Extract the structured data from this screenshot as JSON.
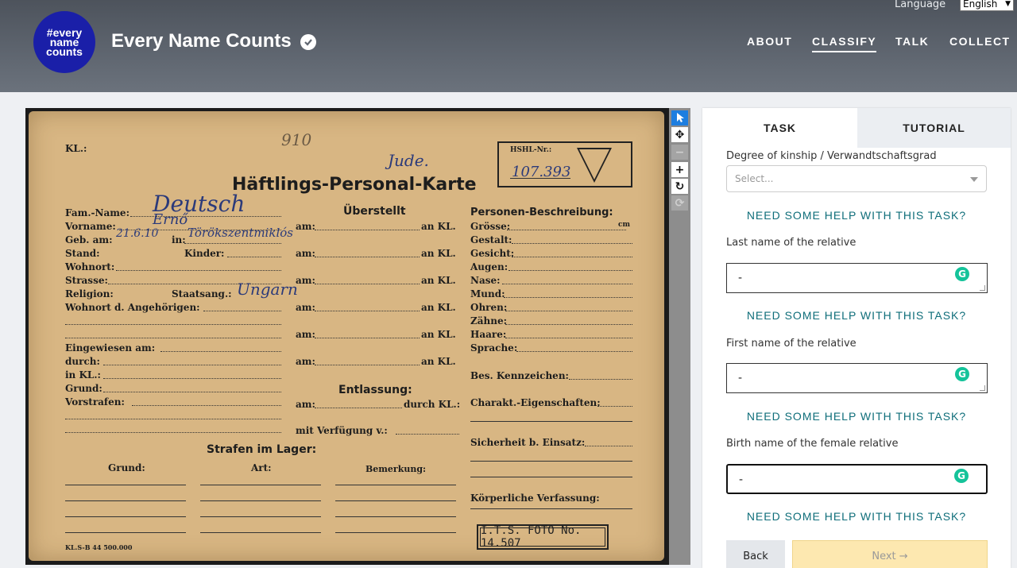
{
  "header": {
    "site_title": "Every Name Counts",
    "logo_text": [
      "#every",
      "name",
      "counts"
    ],
    "language_label": "Language",
    "language_value": "English",
    "nav": [
      {
        "label": "ABOUT",
        "active": false
      },
      {
        "label": "CLASSIFY",
        "active": true
      },
      {
        "label": "TALK",
        "active": false
      },
      {
        "label": "COLLECT",
        "active": false
      }
    ]
  },
  "document": {
    "top_left": "KL.:",
    "pencil_number": "910",
    "hftl_label": "HSHL-Nr.:",
    "prisoner_number": "107.393",
    "category_note": "Jude.",
    "title": "Häftlings-Personal-Karte",
    "left_labels": [
      "Fam.-Name:",
      "Vorname:",
      "Geb. am:",
      "Stand:",
      "Wohnort:",
      "Strasse:",
      "Religion:",
      "Wohnort d. Angehörigen:",
      "Eingewiesen am:",
      "durch:",
      "in KL.:",
      "Grund:",
      "Vorstrafen:"
    ],
    "in_label": "in:",
    "kinder_label": "Kinder:",
    "staatsang_label": "Staatsang.:",
    "family_name": "Deutsch",
    "first_name": "Ernő",
    "birth_date": "21.6.10",
    "birth_place": "Törökszentmiklós",
    "nationality": "Ungarn",
    "ueberstellt": "Überstellt",
    "am_label": "am:",
    "an_kl_label": "an KL.",
    "entlassung": "Entlassung:",
    "durch_kl": "durch KL.:",
    "verfuegung": "mit Verfügung v.:",
    "personen_title": "Personen-Beschreibung:",
    "right_labels": [
      "Grösse:",
      "Gestalt:",
      "Gesicht:",
      "Augen:",
      "Nase:",
      "Mund:",
      "Ohren:",
      "Zähne:",
      "Haare:",
      "Sprache:"
    ],
    "cm_label": "cm",
    "bes_kennzeichen": "Bes. Kennzeichen:",
    "charakt": "Charakt.-Eigenschaften:",
    "sicherheit": "Sicherheit b. Einsatz:",
    "koerper": "Körperliche Verfassung:",
    "strafen_title": "Strafen im Lager:",
    "strafen_cols": [
      "Grund:",
      "Art:",
      "Bemerkung:"
    ],
    "stamp": "I.T.S. FOTO No. 14.507",
    "footer_code": "KL.S-B 44 500.000"
  },
  "toolbar": [
    "select-pointer",
    "move",
    "zoom-out",
    "zoom-in",
    "rotate",
    "reset"
  ],
  "panel": {
    "tabs": {
      "task": "TASK",
      "tutorial": "TUTORIAL"
    },
    "kinship_label": "Degree of kinship / Verwandtschaftsgrad",
    "kinship_placeholder": "Select...",
    "help_text": "NEED SOME HELP WITH THIS TASK?",
    "last_name_label": "Last name of the relative",
    "last_name_value": "-",
    "first_name_label": "First name of the relative",
    "first_name_value": "-",
    "birth_name_label": "Birth name of the female relative",
    "birth_name_value": "-",
    "back_label": "Back",
    "next_label": "Next →"
  },
  "colors": {
    "accent_teal": "#0f6e7a",
    "logo_blue": "#1a1fa8",
    "next_button": "#fde8b0",
    "card_paper": "#d8b683",
    "active_tool": "#1d7ee0"
  }
}
